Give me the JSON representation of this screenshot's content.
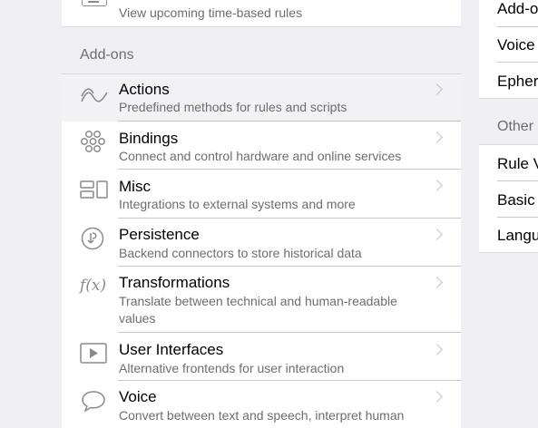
{
  "left_panel": {
    "top_item": {
      "subtitle": "View upcoming time-based rules",
      "icon": "schedule-icon"
    },
    "addons_section": {
      "header": "Add-ons",
      "items": [
        {
          "title": "Actions",
          "subtitle": "Predefined methods for rules and scripts",
          "icon": "wave-icon"
        },
        {
          "title": "Bindings",
          "subtitle": "Connect and control hardware and online services",
          "icon": "circles-grid-icon"
        },
        {
          "title": "Misc",
          "subtitle": "Integrations to external systems and more",
          "icon": "misc-blocks-icon"
        },
        {
          "title": "Persistence",
          "subtitle": "Backend connectors to store historical data",
          "icon": "persistence-icon"
        },
        {
          "title": "Transformations",
          "subtitle": "Translate between technical and human-readable values",
          "icon": "function-icon",
          "icon_text": "f(x)"
        },
        {
          "title": "User Interfaces",
          "subtitle": "Alternative frontends for user interaction",
          "icon": "play-icon"
        },
        {
          "title": "Voice",
          "subtitle": "Convert between text and speech, interpret human",
          "icon": "chat-bubble-icon"
        }
      ]
    }
  },
  "right_panel": {
    "block1_items": [
      "Add-o",
      "Voice",
      "Epher"
    ],
    "section_header": "Other",
    "block2_items": [
      "Rule V",
      "Basic U",
      "Langu"
    ]
  },
  "colors": {
    "background": "#efeff4",
    "card": "#ffffff",
    "selected_row": "#f2f2f4",
    "secondary_text": "#6d6d72",
    "icon_gray": "#8a8a8e"
  }
}
